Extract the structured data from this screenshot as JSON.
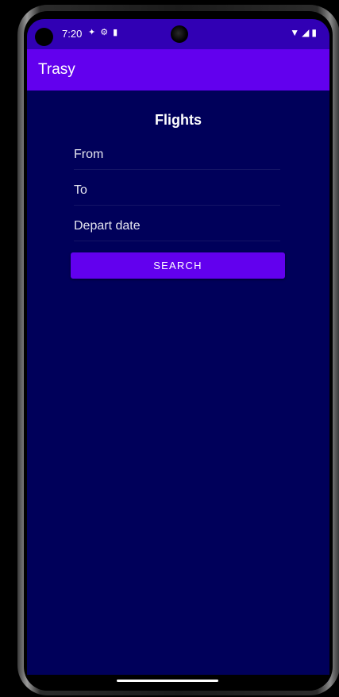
{
  "status_bar": {
    "time": "7:20",
    "icons_left": [
      "accessibility-icon",
      "settings-sync-icon",
      "sim-card-icon"
    ],
    "icons_right": [
      "wifi-icon",
      "signal-icon",
      "battery-icon"
    ]
  },
  "app_bar": {
    "title": "Trasy"
  },
  "page": {
    "title": "Flights"
  },
  "form": {
    "from_placeholder": "From",
    "to_placeholder": "To",
    "depart_placeholder": "Depart date",
    "search_label": "SEARCH"
  },
  "colors": {
    "status_bar": "#3100b4",
    "app_bar": "#6200ee",
    "background": "#00005a",
    "button": "#6200ee"
  }
}
